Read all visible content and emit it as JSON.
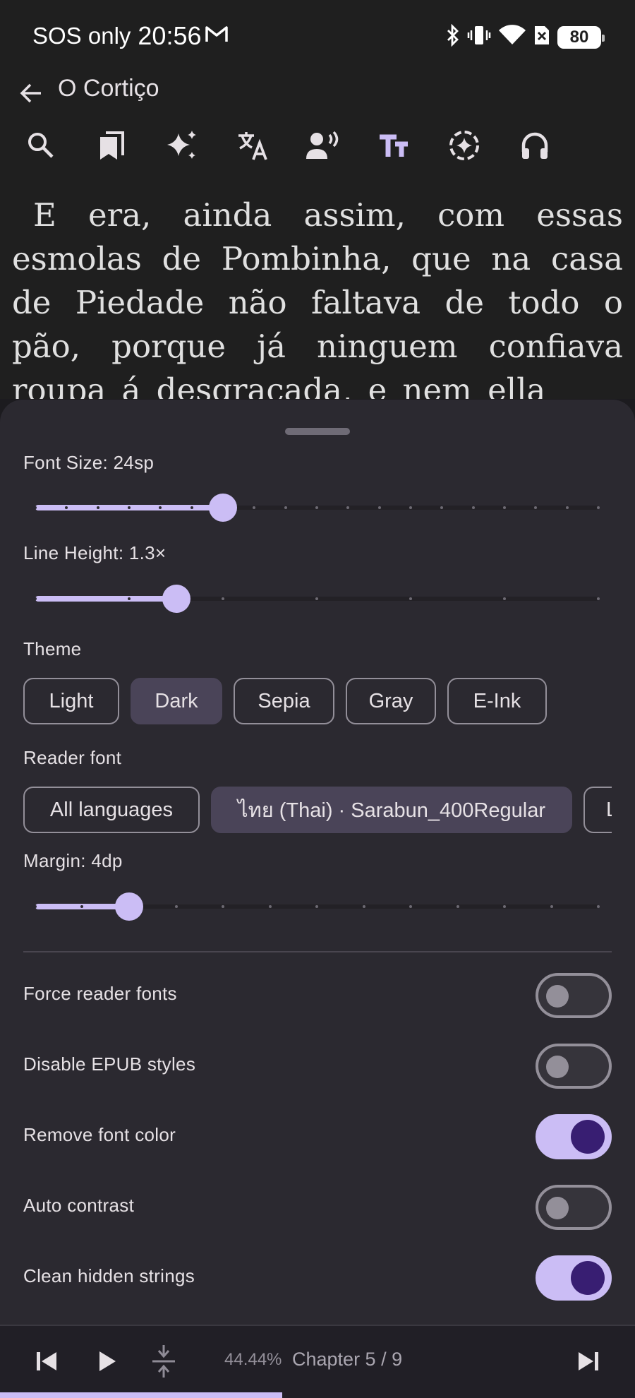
{
  "status_bar": {
    "carrier": "SOS only",
    "time": "20:56",
    "battery": "80"
  },
  "app_bar": {
    "title": "O Cortiço"
  },
  "toolbar": {
    "icons": [
      "search-icon",
      "bookmarks-icon",
      "ai-sparkle-icon",
      "translate-icon",
      "tts-voice-icon",
      "text-format-icon",
      "sync-icon",
      "headphones-icon"
    ],
    "active": "text-format-icon",
    "accent_color": "#cbbdf5"
  },
  "reader": {
    "text": "E era, ainda assim, com essas esmolas de Pombinha, que na casa de Piedade não faltava de todo o pão, porque já ninguem confiava roupa á desgraçada, e nem ella"
  },
  "settings": {
    "font_size_label": "Font Size: 24sp",
    "font_size": {
      "value": 24,
      "min": 12,
      "max": 48,
      "step": 2
    },
    "line_height_label": "Line Height: 1.3×",
    "line_height": {
      "value": 1.3,
      "min": 1.0,
      "max": 2.2,
      "step": 0.2
    },
    "theme_label": "Theme",
    "themes": [
      "Light",
      "Dark",
      "Sepia",
      "Gray",
      "E-Ink"
    ],
    "selected_theme": "Dark",
    "reader_font_label": "Reader font",
    "font_chips": [
      "All languages",
      "ไทย (Thai) · Sarabun_400Regular",
      "L"
    ],
    "selected_font_chip": "ไทย (Thai) · Sarabun_400Regular",
    "margin_label": "Margin: 4dp",
    "margin": {
      "value": 4,
      "min": 0,
      "max": 24,
      "step": 2
    },
    "toggles": [
      {
        "label": "Force reader fonts",
        "on": false
      },
      {
        "label": "Disable EPUB styles",
        "on": false
      },
      {
        "label": "Remove font color",
        "on": true
      },
      {
        "label": "Auto contrast",
        "on": false
      },
      {
        "label": "Clean hidden strings",
        "on": true
      }
    ]
  },
  "footer": {
    "progress_text": "44.44%",
    "chapter_text": "Chapter 5 / 9",
    "progress_fraction": 0.4444
  }
}
